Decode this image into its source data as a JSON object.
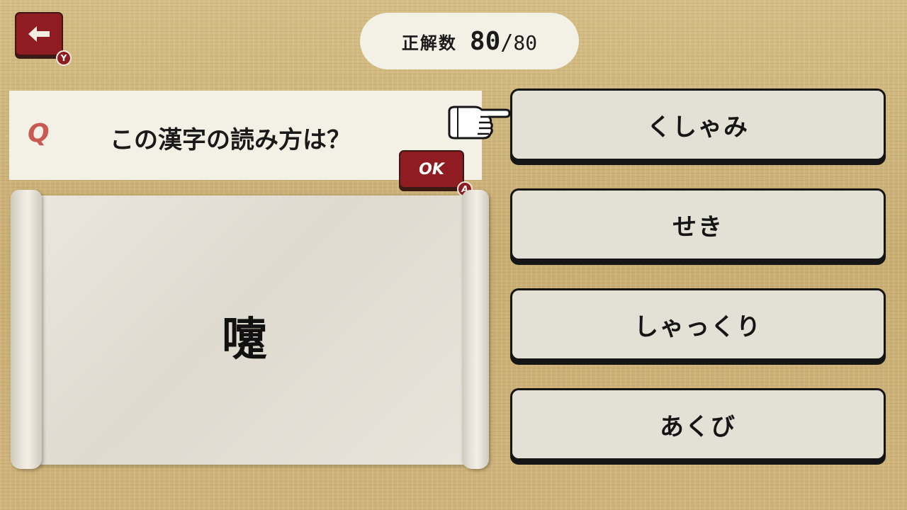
{
  "header": {
    "back_button": {
      "icon": "arrow-left-icon",
      "hint_key": "Y"
    },
    "score": {
      "label": "正解数",
      "current": "80",
      "separator": "/",
      "total": "80"
    }
  },
  "question": {
    "marker": "Q",
    "text": "この漢字の読み方は？",
    "confirm_button": {
      "label": "OK",
      "hint_key": "A"
    }
  },
  "kanji": "嚔",
  "choices": [
    {
      "label": "くしゃみ",
      "selected": true
    },
    {
      "label": "せき",
      "selected": false
    },
    {
      "label": "しゃっくり",
      "selected": false
    },
    {
      "label": "あくび",
      "selected": false
    }
  ],
  "colors": {
    "accent": "#8e1c20",
    "panel": "#f3f0e6",
    "choice_bg": "#e3e0d6",
    "q_marker": "#c95a52"
  }
}
